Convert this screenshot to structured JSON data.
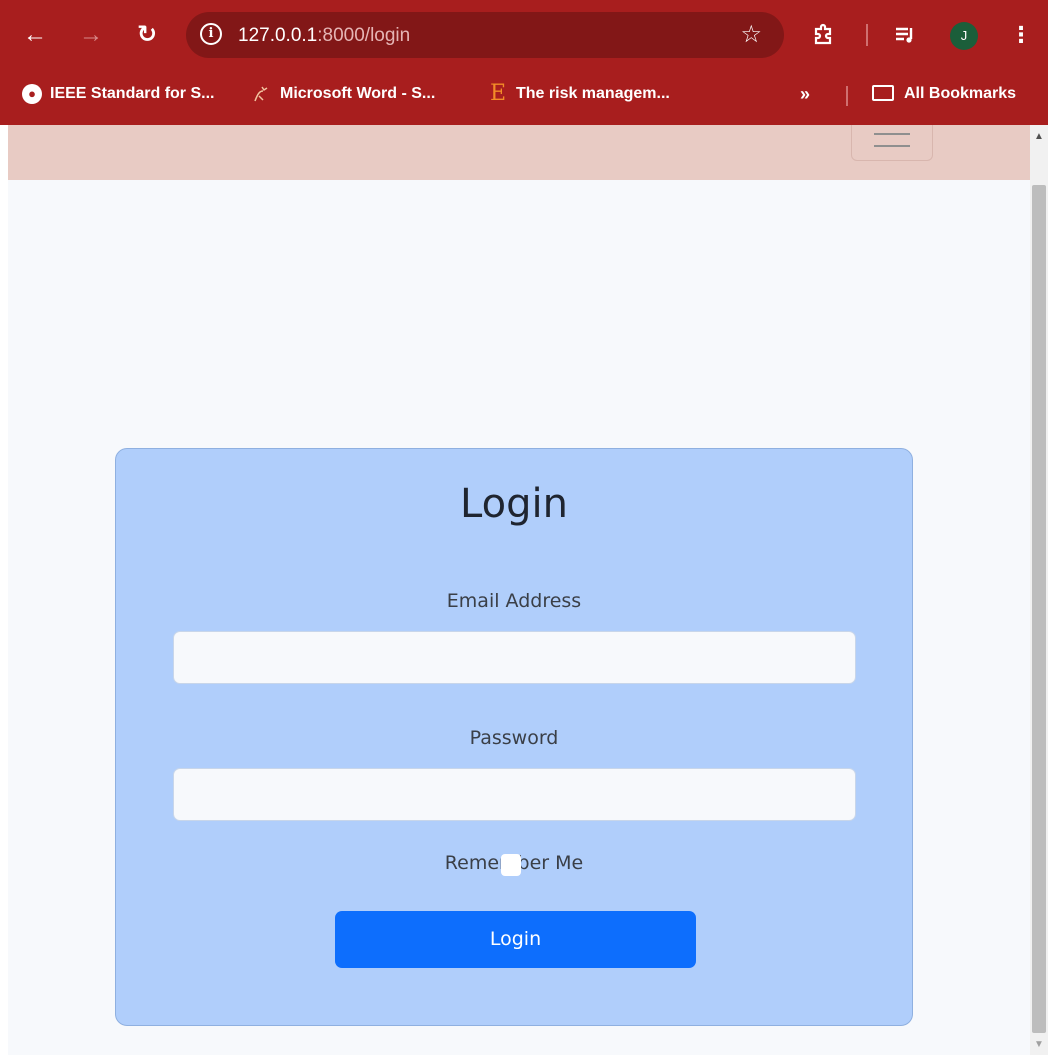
{
  "browser": {
    "url_host": "127.0.0.1",
    "url_rest": ":8000/login",
    "avatar_initial": "J",
    "bookmarks": [
      {
        "label": "IEEE Standard for S...",
        "icon": "globe-icon"
      },
      {
        "label": "Microsoft Word - S...",
        "icon": "document-icon"
      },
      {
        "label": "The risk managem...",
        "icon": "e-letter-icon"
      }
    ],
    "more_label": "»",
    "all_bookmarks_label": "All Bookmarks",
    "colors": {
      "toolbar": "#a81e1e",
      "omnibox": "#821717"
    }
  },
  "page": {
    "navbar_color": "#e8cbc4",
    "card": {
      "title": "Login",
      "email_label": "Email Address",
      "email_value": "",
      "password_label": "Password",
      "password_value": "",
      "remember_label": "Remember Me",
      "remember_checked": false,
      "submit_label": "Login",
      "colors": {
        "card_bg": "#b0cefb",
        "button": "#0d6efd"
      }
    }
  }
}
